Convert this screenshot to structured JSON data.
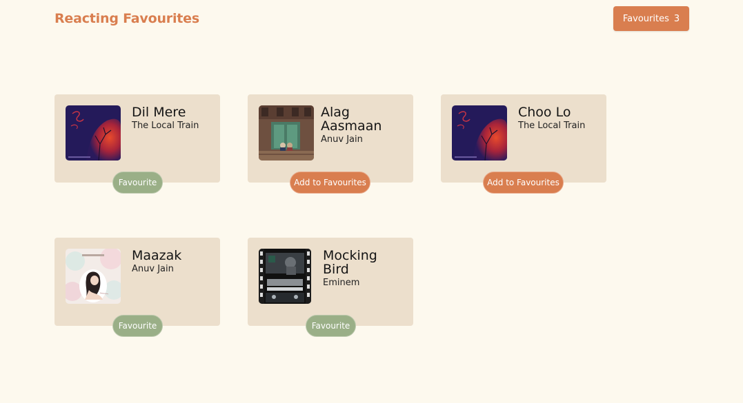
{
  "header": {
    "title": "Reacting Favourites",
    "favourites_button": {
      "label": "Favourites",
      "count": "3"
    }
  },
  "colors": {
    "background": "#fdf9ee",
    "card": "#ecdfcc",
    "accent": "#d97e4f",
    "favourited": "#9aaf87"
  },
  "songs": [
    {
      "title": "Dil Mere",
      "artist": "The Local Train",
      "cover_icon": "album-art-dil-mere",
      "favourited": true,
      "button_label": "Favourite"
    },
    {
      "title": "Alag Aasmaan",
      "artist": "Anuv Jain",
      "cover_icon": "album-art-alag-aasmaan",
      "favourited": false,
      "button_label": "Add to Favourites"
    },
    {
      "title": "Choo Lo",
      "artist": "The Local Train",
      "cover_icon": "album-art-choo-lo",
      "favourited": false,
      "button_label": "Add to Favourites"
    },
    {
      "title": "Maazak",
      "artist": "Anuv Jain",
      "cover_icon": "album-art-maazak",
      "favourited": true,
      "button_label": "Favourite"
    },
    {
      "title": "Mocking Bird",
      "artist": "Eminem",
      "cover_icon": "album-art-mocking-bird",
      "favourited": true,
      "button_label": "Favourite"
    }
  ]
}
